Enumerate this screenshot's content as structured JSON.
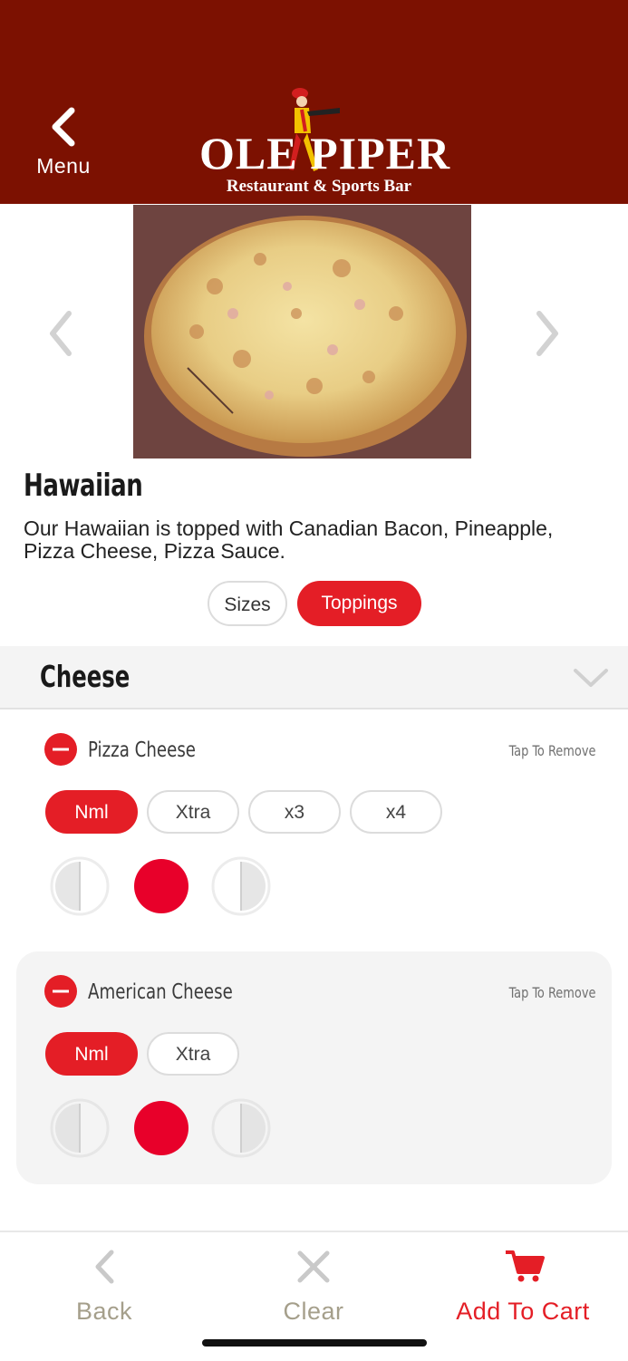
{
  "header": {
    "back_label": "Menu",
    "logo_name": "OLE PIPER",
    "logo_tagline": "Restaurant & Sports Bar"
  },
  "item": {
    "title": "Hawaiian",
    "description": "Our Hawaiian is topped with Canadian Bacon, Pineapple, Pizza Cheese, Pizza Sauce."
  },
  "tabs": [
    {
      "label": "Sizes",
      "selected": false
    },
    {
      "label": "Toppings",
      "selected": true
    }
  ],
  "section": {
    "title": "Cheese"
  },
  "toppings": [
    {
      "name": "Pizza Cheese",
      "action": "Tap To Remove",
      "amounts": [
        {
          "label": "Nml",
          "selected": true
        },
        {
          "label": "Xtra",
          "selected": false
        },
        {
          "label": "x3",
          "selected": false
        },
        {
          "label": "x4",
          "selected": false
        }
      ],
      "placement": "whole"
    },
    {
      "name": "American Cheese",
      "action": "Tap To Remove",
      "amounts": [
        {
          "label": "Nml",
          "selected": true
        },
        {
          "label": "Xtra",
          "selected": false
        }
      ],
      "placement": "whole"
    }
  ],
  "bottom_bar": {
    "back_label": "Back",
    "clear_label": "Clear",
    "cart_label": "Add To Cart"
  },
  "colors": {
    "header_bg": "#7c1101",
    "accent_red": "#e41e26",
    "muted_text": "#a59f8b"
  },
  "icons": [
    "chevron-left-icon",
    "chevron-right-icon",
    "chevron-down-icon",
    "minus-circle-icon",
    "close-icon",
    "cart-icon"
  ]
}
